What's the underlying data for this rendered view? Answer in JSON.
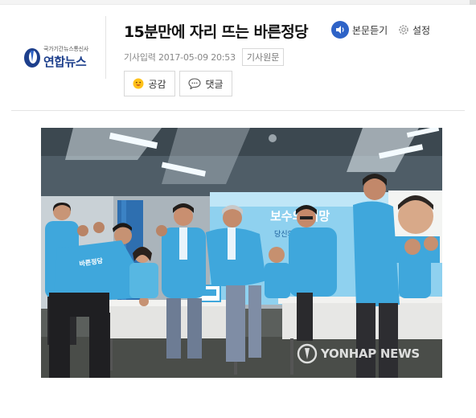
{
  "brand": {
    "sub": "국가기간뉴스통신사",
    "name": "연합뉴스"
  },
  "article": {
    "title": "15분만에 자리 뜨는 바른정당",
    "meta_date": "기사입력 2017-05-09 20:53",
    "original_link": "기사원문"
  },
  "tools": {
    "listen_label": "본문듣기",
    "settings_label": "설정"
  },
  "reactions": {
    "like_label": "공감",
    "comment_label": "댓글"
  },
  "photo": {
    "banner_line1": "보수의 희망",
    "banner_line2": "당신의 능력을 …",
    "vest_text": "바른정당",
    "watermark": "YONHAP NEWS"
  },
  "colors": {
    "brand_blue": "#1d3f8c",
    "listen_blue": "#2e63c7",
    "party_blue": "#3fa7dc"
  }
}
